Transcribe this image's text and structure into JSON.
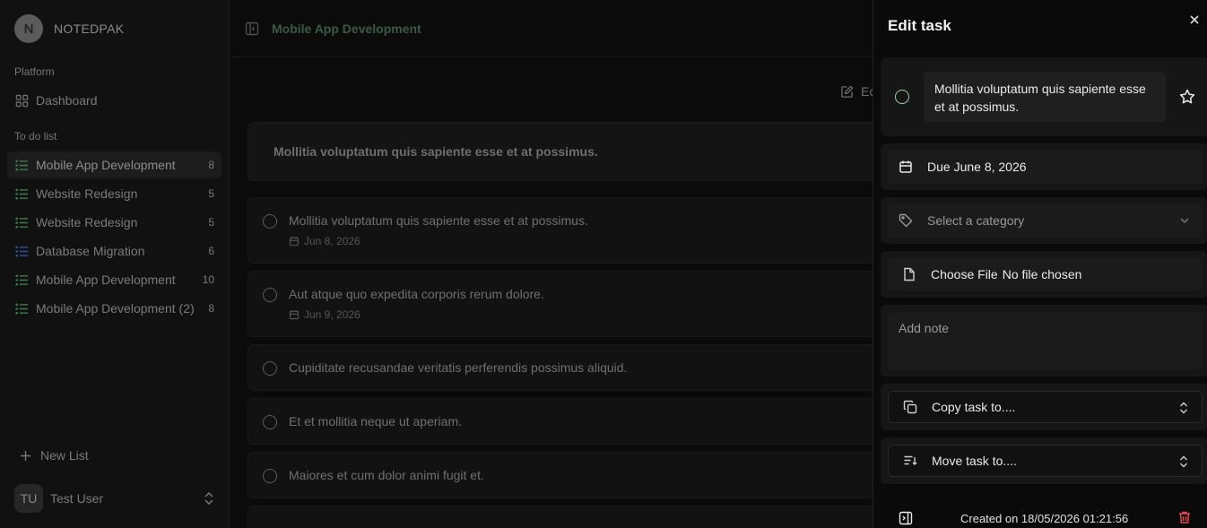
{
  "app": {
    "brand": "NOTEDPAK",
    "logo_letter": "N"
  },
  "sidebar": {
    "platform_label": "Platform",
    "dashboard_label": "Dashboard",
    "todo_label": "To do list",
    "lists": [
      {
        "label": "Mobile App Development",
        "count": "8",
        "active": true,
        "icon_color": "#3f7a4e"
      },
      {
        "label": "Website Redesign",
        "count": "5",
        "icon_color": "#3f7a4e"
      },
      {
        "label": "Website Redesign",
        "count": "5",
        "icon_color": "#3f7a4e"
      },
      {
        "label": "Database Migration",
        "count": "6",
        "icon_color": "#2f4f9a"
      },
      {
        "label": "Mobile App Development",
        "count": "10",
        "icon_color": "#3f7a4e"
      },
      {
        "label": "Mobile App Development (2)",
        "count": "8",
        "icon_color": "#3f7a4e"
      }
    ],
    "new_list_label": "New List",
    "user": {
      "initials": "TU",
      "name": "Test User"
    }
  },
  "main": {
    "title": "Mobile App Development",
    "edit_label": "Ec",
    "list_header": "Mollitia voluptatum quis sapiente esse et at possimus.",
    "tasks": [
      {
        "title": "Mollitia voluptatum quis sapiente esse et at possimus.",
        "date": "Jun 8, 2026"
      },
      {
        "title": "Aut atque quo expedita corporis rerum dolore.",
        "date": "Jun 9, 2026"
      },
      {
        "title": "Cupiditate recusandae veritatis perferendis possimus aliquid.",
        "date": ""
      },
      {
        "title": "Et et mollitia neque ut aperiam.",
        "date": ""
      },
      {
        "title": "Maiores et cum dolor animi fugit et.",
        "date": ""
      }
    ]
  },
  "drawer": {
    "title": "Edit task",
    "task_title": "Mollitia voluptatum quis sapiente esse et at possimus.",
    "due": "Due June 8, 2026",
    "category_placeholder": "Select a category",
    "file_button": "Choose File",
    "file_status": "No file chosen",
    "note_placeholder": "Add note",
    "copy_label": "Copy task to....",
    "move_label": "Move task to....",
    "created": "Created on 18/05/2026 01:21:56"
  },
  "colors": {
    "accent": "#9bd3a6",
    "danger": "#e5484d"
  }
}
